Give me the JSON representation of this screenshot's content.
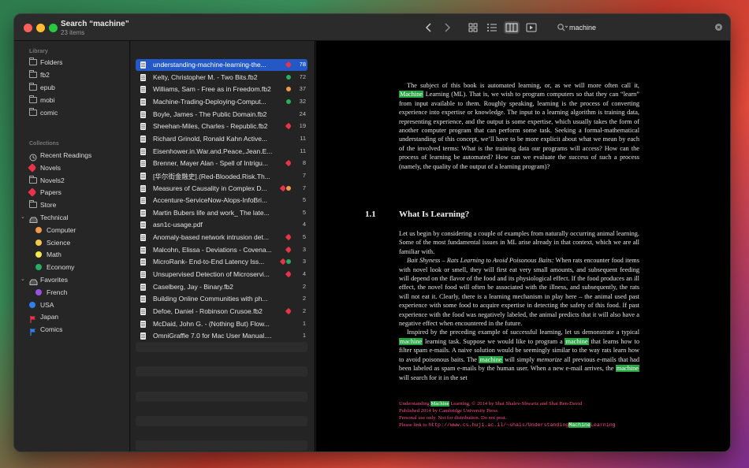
{
  "window": {
    "title": "Search “machine”",
    "subtitle": "23 items"
  },
  "search": {
    "value": "machine"
  },
  "sidebar": {
    "library_header": "Library",
    "library": [
      {
        "label": "Folders",
        "icon": "folder-icon"
      },
      {
        "label": "fb2",
        "icon": "folder-icon"
      },
      {
        "label": "epub",
        "icon": "folder-icon"
      },
      {
        "label": "mobi",
        "icon": "folder-icon"
      },
      {
        "label": "comic",
        "icon": "folder-icon"
      }
    ],
    "collections_header": "Collections",
    "collections": [
      {
        "label": "Recent Readings",
        "icon": "clock-icon"
      },
      {
        "label": "Novels",
        "icon": "tag-icon",
        "color": "#e8334a"
      },
      {
        "label": "Novels2",
        "icon": "folder-icon"
      },
      {
        "label": "Papers",
        "icon": "tag-icon",
        "color": "#e8334a"
      },
      {
        "label": "Store",
        "icon": "folder-icon"
      },
      {
        "label": "Technical",
        "icon": "tray-icon"
      },
      {
        "label": "Computer",
        "icon": "dot-icon",
        "color": "#f2994a"
      },
      {
        "label": "Science",
        "icon": "dot-icon",
        "color": "#f2c94c"
      },
      {
        "label": "Math",
        "icon": "dot-icon",
        "color": "#f2e94c"
      },
      {
        "label": "Economy",
        "icon": "dot-icon",
        "color": "#27ae60"
      },
      {
        "label": "Favorites",
        "icon": "tray-icon"
      },
      {
        "label": "French",
        "icon": "dot-icon",
        "color": "#9b51e0"
      },
      {
        "label": "USA",
        "icon": "dot-icon",
        "color": "#2f80ed"
      },
      {
        "label": "Japan",
        "icon": "flag-icon",
        "color": "#e8334a"
      },
      {
        "label": "Comics",
        "icon": "flag-icon",
        "color": "#2f80ed"
      }
    ]
  },
  "results": [
    {
      "title": "understanding-machine-learning-the...",
      "count": "78",
      "tags": [
        "#e8334a"
      ]
    },
    {
      "title": "Kelty, Christopher M. - Two Bits.fb2",
      "count": "72",
      "tags": [
        "#27ae60"
      ]
    },
    {
      "title": "Williams, Sam - Free as in Freedom.fb2",
      "count": "37",
      "tags": [
        "#f2994a"
      ]
    },
    {
      "title": "Machine-Trading-Deploying-Comput...",
      "count": "32",
      "tags": [
        "#27ae60"
      ]
    },
    {
      "title": "Boyle, James - The Public Domain.fb2",
      "count": "24",
      "tags": []
    },
    {
      "title": "Sheehan-Miles, Charles - Republic.fb2",
      "count": "19",
      "tags": [
        "#e8334a"
      ]
    },
    {
      "title": "Richard Grinold, Ronald Kahn Active...",
      "count": "11",
      "tags": []
    },
    {
      "title": "Eisenhower.in.War.and.Peace,.Jean.E...",
      "count": "11",
      "tags": []
    },
    {
      "title": "Brenner, Mayer Alan - Spell of Intrigu...",
      "count": "8",
      "tags": [
        "#e8334a"
      ]
    },
    {
      "title": "[华尔街金融史].(Red-Blooded.Risk.Th...",
      "count": "7",
      "tags": []
    },
    {
      "title": "Measures of Causality in Complex D...",
      "count": "7",
      "tags": [
        "#e8334a",
        "#f2994a"
      ]
    },
    {
      "title": "Accenture-ServiceNow-Alops-InfoBri...",
      "count": "5",
      "tags": []
    },
    {
      "title": "Martin Bubers life and work_ The late...",
      "count": "5",
      "tags": []
    },
    {
      "title": "asn1c-usage.pdf",
      "count": "4",
      "tags": []
    },
    {
      "title": "Anomaly-based network intrusion det...",
      "count": "5",
      "tags": [
        "#e8334a"
      ]
    },
    {
      "title": "Malcohn, Elissa - Deviations - Covena...",
      "count": "3",
      "tags": [
        "#e8334a"
      ]
    },
    {
      "title": "MicroRank- End-to-End Latency Iss...",
      "count": "3",
      "tags": [
        "#e8334a",
        "#27ae60"
      ]
    },
    {
      "title": "Unsupervised Detection of Microservi...",
      "count": "4",
      "tags": [
        "#e8334a"
      ]
    },
    {
      "title": "Caselberg, Jay - Binary.fb2",
      "count": "2",
      "tags": []
    },
    {
      "title": "Building Online Communities with ph...",
      "count": "2",
      "tags": []
    },
    {
      "title": "Defoe, Daniel - Robinson Crusoe.fb2",
      "count": "2",
      "tags": [
        "#e8334a"
      ]
    },
    {
      "title": "McDaid, John G. - (Nothing But) Flow...",
      "count": "1",
      "tags": []
    },
    {
      "title": "OmniGraffle 7.0 for Mac User Manual....",
      "count": "1",
      "tags": []
    }
  ],
  "document": {
    "p1a": "The subject of this book is automated learning, or, as we will more often call it, ",
    "p1hl": "Machine",
    "p1b": " Learning (ML). That is, we wish to program computers so that they can “learn” from input available to them. Roughly speaking, learning is the process of converting experience into expertise or knowledge. The input to a learning algorithm is training data, representing experience, and the output is some expertise, which usually takes the form of another computer program that can perform some task. Seeking a formal-mathematical understanding of this concept, we’ll have to be more explicit about what we mean by each of the involved terms: What is the training data our programs will access? How can the process of learning be automated? How can we evaluate the success of such a process (namely, the quality of the output of a learning program)?",
    "section_number": "1.1",
    "section_title": "What Is Learning?",
    "p2": "Let us begin by considering a couple of examples from naturally occurring animal learning. Some of the most fundamental issues in ML arise already in that context, which we are all familiar with.",
    "p3em": "Bait Shyness – Rats Learning to Avoid Poisonous Baits:",
    "p3": " When rats encounter food items with novel look or smell, they will first eat very small amounts, and subsequent feeding will depend on the flavor of the food and its physiological effect. If the food produces an ill effect, the novel food will often be associated with the illness, and subsequently, the rats will not eat it. Clearly, there is a learning mechanism in play here – the animal used past experience with some food to acquire expertise in detecting the safety of this food. If past experience with the food was negatively labeled, the animal predicts that it will also have a negative effect when encountered in the future.",
    "p4a": "Inspired by the preceding example of successful learning, let us demonstrate a typical ",
    "p4hl1": "machine",
    "p4b": " learning task. Suppose we would like to program a ",
    "p4hl2": "machine",
    "p4c": " that learns how to filter spam e-mails. A naive solution would be seemingly similar to the way rats learn how to avoid poisonous baits. The ",
    "p4hl3": "machine",
    "p4d": " will simply ",
    "p4em": "memorize",
    "p4e": " all previous e-mails that had been labeled as spam e-mails by the human user. When a new e-mail arrives, the ",
    "p4hl4": "machine",
    "p4f": " will search for it in the set",
    "f1a": "Understanding ",
    "f1hl": "Machine",
    "f1b": " Learning, © 2014 by Shai Shalev-Shwartz and Shai Ben-David",
    "f2": "Published 2014 by Cambridge University Press.",
    "f3": "Personal use only. Not for distribution. Do not post.",
    "f4a": "Please link to ",
    "f4m1": "http://www.cs.huji.ac.il/~shais/Understanding",
    "f4hl": "Machine",
    "f4m2": "Learning"
  }
}
